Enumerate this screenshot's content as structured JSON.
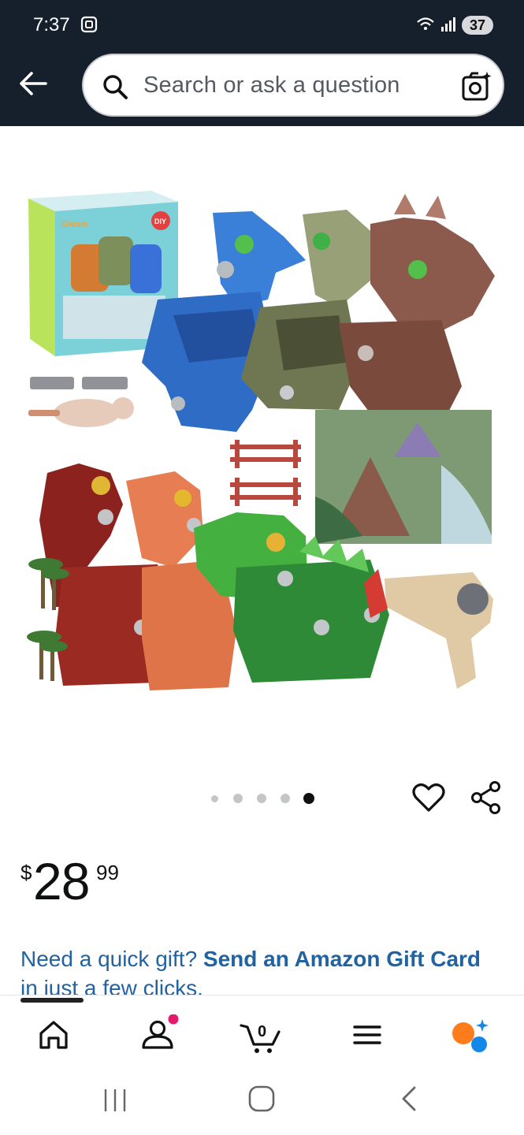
{
  "status": {
    "time": "7:37",
    "battery": "37"
  },
  "search": {
    "placeholder": "Search or ask a question"
  },
  "product": {
    "image_count": 5,
    "active_image": 5,
    "price_symbol": "$",
    "price_whole": "28",
    "price_fraction": "99",
    "box_brand": "Gleam",
    "box_badge": "DIY"
  },
  "gift": {
    "prefix": "Need a quick gift? ",
    "link": "Send an Amazon Gift Card",
    "suffix_link": "in just",
    "suffix": " a few clicks."
  },
  "nav": {
    "cart_count": "0"
  },
  "colors": {
    "topbar": "#16202c",
    "link": "#2162a1",
    "badge_dot": "#e3196c",
    "alexa_orange": "#ff7c1d",
    "alexa_blue": "#1488e8"
  },
  "icons": [
    "back-arrow-icon",
    "search-icon",
    "camera-search-icon",
    "heart-icon",
    "share-icon",
    "home-icon",
    "account-icon",
    "cart-icon",
    "menu-icon",
    "rufus-assistant-icon"
  ]
}
